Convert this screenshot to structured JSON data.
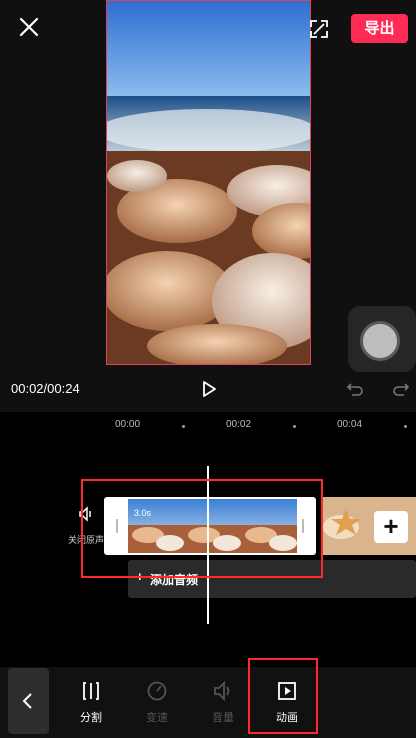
{
  "topbar": {
    "close_icon": "close-icon",
    "fullscreen_icon": "fullscreen-icon",
    "export_label": "导出"
  },
  "playback": {
    "time": "00:02/00:24",
    "play_icon": "play-icon",
    "undo_icon": "undo-icon",
    "redo_icon": "redo-icon"
  },
  "timeline": {
    "ruler": [
      "00:00",
      "00:02",
      "00:04"
    ],
    "mute_label": "关闭原声",
    "clip_duration": "3.0s",
    "add_audio_label": "添加音频",
    "add_clip_symbol": "+"
  },
  "toolbar": {
    "items": [
      {
        "label": "分割",
        "icon": "split-icon",
        "enabled": true
      },
      {
        "label": "变速",
        "icon": "speed-icon",
        "enabled": false
      },
      {
        "label": "音量",
        "icon": "volume-icon",
        "enabled": false
      },
      {
        "label": "动画",
        "icon": "animation-icon",
        "enabled": true
      }
    ]
  },
  "colors": {
    "accent": "#fe2c55",
    "highlight": "#ff2a2a"
  }
}
